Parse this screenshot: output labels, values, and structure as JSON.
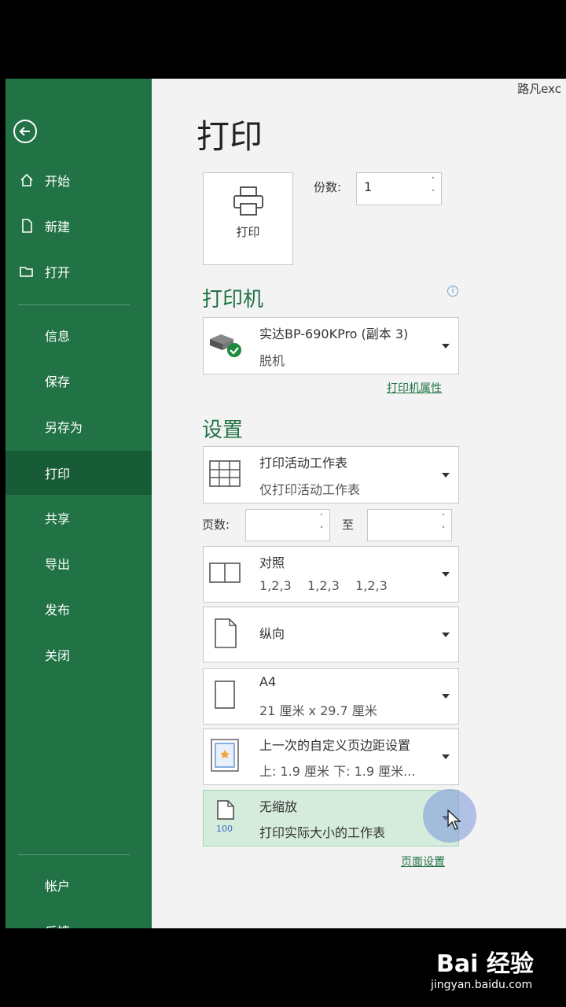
{
  "watermark_top": "路凡exc",
  "sidebar": {
    "items": [
      {
        "label": "开始",
        "icon": "home-icon"
      },
      {
        "label": "新建",
        "icon": "new-file-icon"
      },
      {
        "label": "打开",
        "icon": "folder-open-icon"
      },
      {
        "label": "信息"
      },
      {
        "label": "保存"
      },
      {
        "label": "另存为"
      },
      {
        "label": "打印",
        "active": true
      },
      {
        "label": "共享"
      },
      {
        "label": "导出"
      },
      {
        "label": "发布"
      },
      {
        "label": "关闭"
      },
      {
        "label": "帐户"
      },
      {
        "label": "反馈"
      }
    ]
  },
  "main": {
    "title": "打印",
    "print_button_label": "打印",
    "copies_label": "份数:",
    "copies_value": "1",
    "printer": {
      "section_title": "打印机",
      "name": "实达BP-690KPro (副本 3)",
      "status": "脱机",
      "properties_link": "打印机属性"
    },
    "settings": {
      "section_title": "设置",
      "print_what": {
        "title": "打印活动工作表",
        "subtitle": "仅打印活动工作表"
      },
      "pages_label": "页数:",
      "pages_to_label": "至",
      "collate": {
        "title": "对照",
        "subtitle": "1,2,3    1,2,3    1,2,3"
      },
      "orientation": {
        "title": "纵向"
      },
      "paper": {
        "title": "A4",
        "subtitle": "21 厘米 x 29.7 厘米"
      },
      "margins": {
        "title": "上一次的自定义页边距设置",
        "subtitle": "上: 1.9 厘米 下: 1.9 厘米..."
      },
      "scaling": {
        "title": "无缩放",
        "subtitle": "打印实际大小的工作表",
        "icon_text": "100"
      },
      "page_setup_link": "页面设置"
    }
  },
  "baidu_watermark": {
    "logo": "Bai 经验",
    "url": "jingyan.baidu.com"
  },
  "colors": {
    "accent": "#217346",
    "accent_dark": "#185c37",
    "selected_bg": "#d5ecdc"
  }
}
